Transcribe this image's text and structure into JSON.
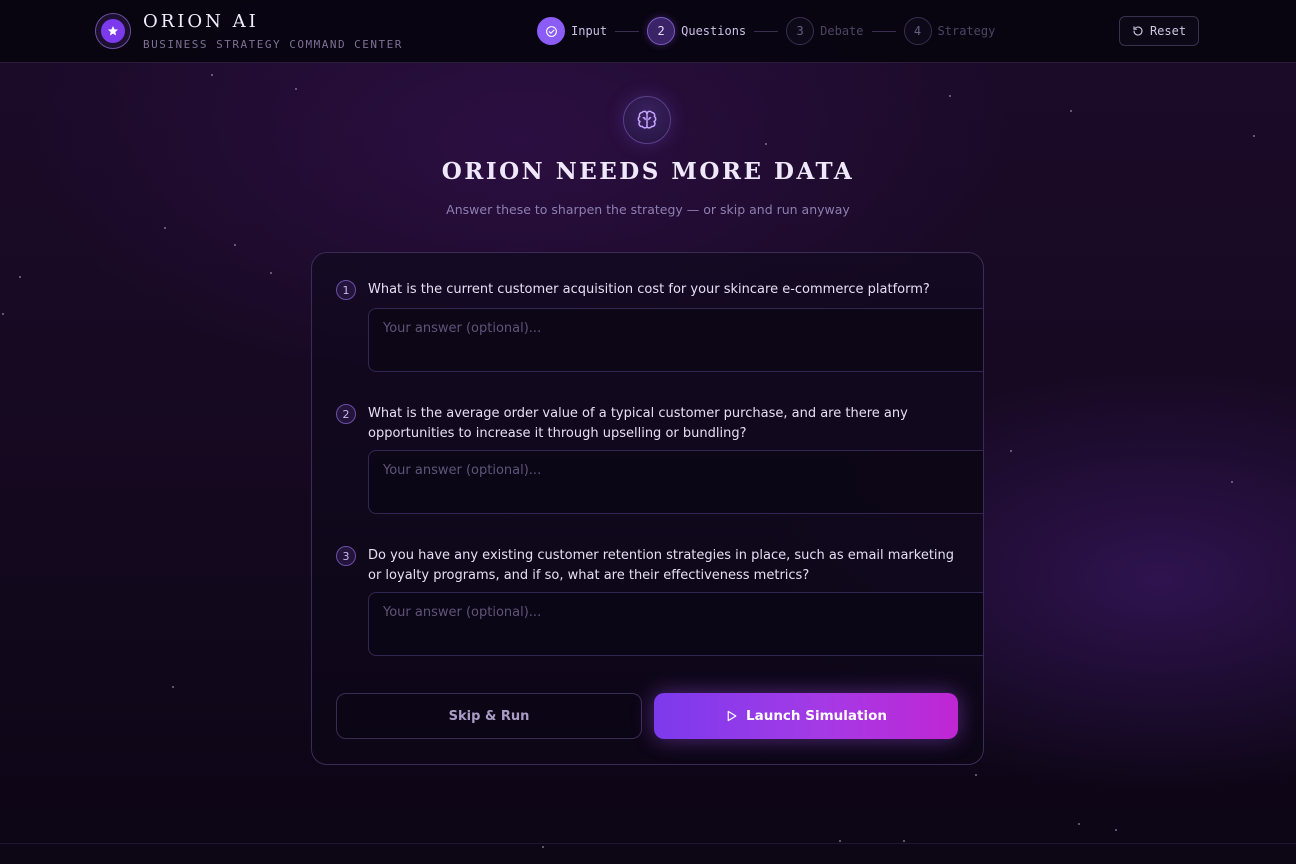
{
  "brand": {
    "title": "ORION AI",
    "subtitle": "BUSINESS STRATEGY COMMAND CENTER",
    "logo_icon": "star-icon"
  },
  "steps": [
    {
      "number": "1",
      "label": "Input",
      "state": "done",
      "icon": "check-icon"
    },
    {
      "number": "2",
      "label": "Questions",
      "state": "active"
    },
    {
      "number": "3",
      "label": "Debate",
      "state": "pending"
    },
    {
      "number": "4",
      "label": "Strategy",
      "state": "pending"
    }
  ],
  "header": {
    "reset_label": "Reset",
    "reset_icon": "refresh-icon"
  },
  "hero": {
    "icon": "brain-icon",
    "title": "ORION NEEDS MORE DATA",
    "subtitle": "Answer these to sharpen the strategy — or skip and run anyway"
  },
  "questions": [
    {
      "number": "1",
      "text": "What is the current customer acquisition cost for your skincare e-commerce platform?",
      "placeholder": "Your answer (optional)...",
      "value": ""
    },
    {
      "number": "2",
      "text": "What is the average order value of a typical customer purchase, and are there any opportunities to increase it through upselling or bundling?",
      "placeholder": "Your answer (optional)...",
      "value": ""
    },
    {
      "number": "3",
      "text": "Do you have any existing customer retention strategies in place, such as email marketing or loyalty programs, and if so, what are their effectiveness metrics?",
      "placeholder": "Your answer (optional)...",
      "value": ""
    }
  ],
  "actions": {
    "skip_label": "Skip & Run",
    "launch_label": "Launch Simulation",
    "launch_icon": "play-icon"
  },
  "colors": {
    "accent": "#8b5cf6",
    "accent_gradient_end": "#c026d3",
    "background": "#170922"
  }
}
